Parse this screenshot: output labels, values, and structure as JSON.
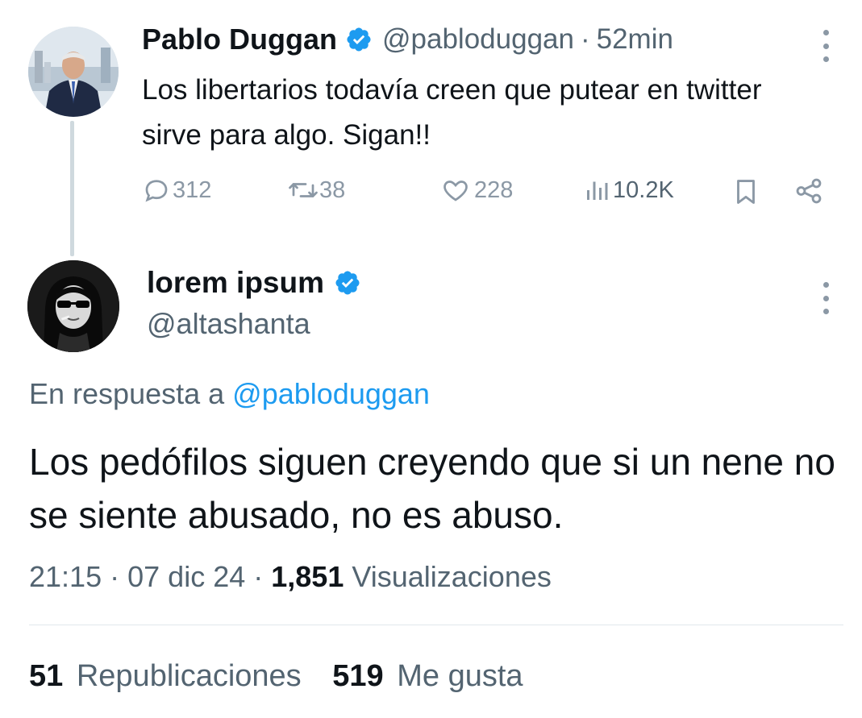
{
  "parent_tweet": {
    "author_name": "Pablo Duggan",
    "handle": "@pabloduggan",
    "separator": "·",
    "time_ago": "52min",
    "text": "Los libertarios todavía creen que putear en twitter sirve para algo. Sigan!!",
    "replies": "312",
    "reposts": "38",
    "likes": "228",
    "views": "10.2K"
  },
  "reply_tweet": {
    "author_name": "lorem ipsum",
    "handle": "@altashanta",
    "replying_prefix": "En respuesta a",
    "replying_to": "@pabloduggan",
    "text": "Los pedófilos siguen creyendo que si un nene no se siente abusado, no es abuso.",
    "time": "21:15",
    "date": "07 dic 24",
    "view_count": "1,851",
    "view_label": "Visualizaciones",
    "repost_count": "51",
    "repost_label": "Republicaciones",
    "like_count": "519",
    "like_label": "Me gusta"
  },
  "icons": {
    "verified": "verified-badge-icon",
    "reply": "reply-icon",
    "repost": "repost-icon",
    "like": "heart-icon",
    "views": "views-chart-icon",
    "bookmark": "bookmark-icon",
    "share": "share-icon",
    "more": "more-options-icon"
  },
  "colors": {
    "accent": "#1d9bf0",
    "text_primary": "#0f1419",
    "text_secondary": "#536471",
    "icon_muted": "#8b98a5"
  }
}
